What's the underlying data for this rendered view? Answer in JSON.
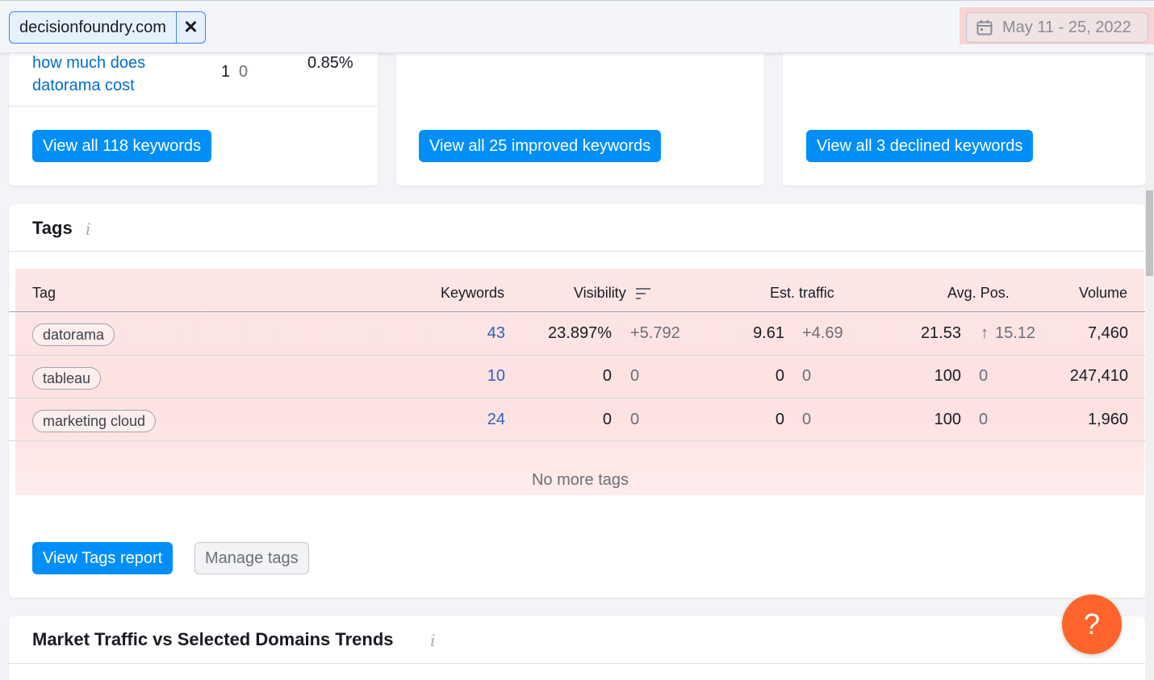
{
  "topbar": {
    "domain": "decisionfoundry.com",
    "remove_label": "✕",
    "date_range": "May 11 - 25, 2022"
  },
  "keyword_cards": {
    "row": {
      "keyword": "how much does datorama cost",
      "position": "1",
      "change": "0",
      "visibility": "0.85%"
    },
    "view_all": "View all 118 keywords",
    "view_improved": "View all 25 improved keywords",
    "view_declined": "View all 3 declined keywords"
  },
  "tags": {
    "title": "Tags",
    "info": "i",
    "columns": {
      "tag": "Tag",
      "keywords": "Keywords",
      "visibility": "Visibility",
      "traffic": "Est. traffic",
      "avg_pos": "Avg. Pos.",
      "volume": "Volume"
    },
    "rows": [
      {
        "tag": "datorama",
        "keywords": "43",
        "visibility": "23.897%",
        "visibility_change": "+5.792",
        "traffic": "9.61",
        "traffic_change": "+4.69",
        "avg_pos": "21.53",
        "avg_pos_change": "15.12",
        "avg_pos_arrow": "↑",
        "volume": "7,460"
      },
      {
        "tag": "tableau",
        "keywords": "10",
        "visibility": "0",
        "visibility_change": "0",
        "traffic": "0",
        "traffic_change": "0",
        "avg_pos": "100",
        "avg_pos_change": "0",
        "avg_pos_arrow": "",
        "volume": "247,410"
      },
      {
        "tag": "marketing cloud",
        "keywords": "24",
        "visibility": "0",
        "visibility_change": "0",
        "traffic": "0",
        "traffic_change": "0",
        "avg_pos": "100",
        "avg_pos_change": "0",
        "avg_pos_arrow": "",
        "volume": "1,960"
      }
    ],
    "no_more": "No more tags",
    "view_report": "View Tags report",
    "manage": "Manage tags"
  },
  "market": {
    "title": "Market Traffic vs Selected Domains Trends",
    "info": "i"
  },
  "help": {
    "label": "?"
  },
  "colors": {
    "primary": "#008ff8",
    "link": "#006dca",
    "help": "#ff642d",
    "highlight": "#fcd2d2"
  }
}
